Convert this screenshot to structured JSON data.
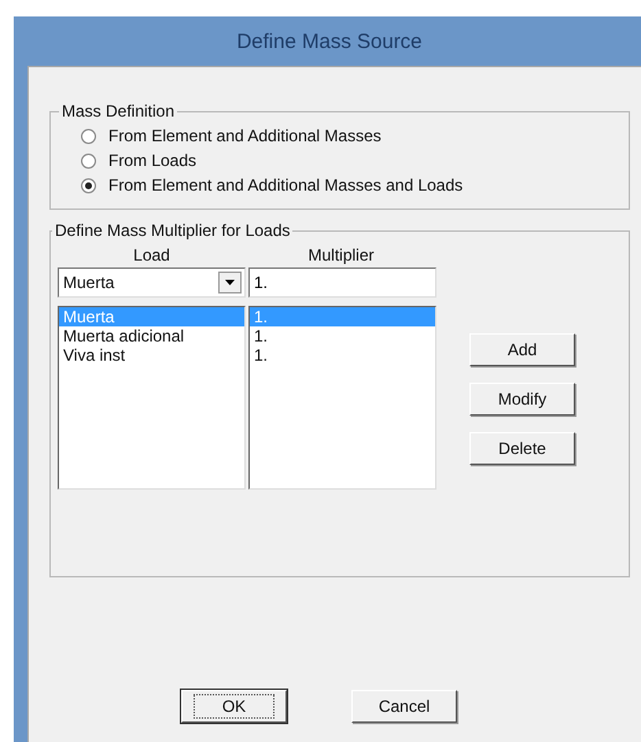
{
  "window": {
    "title": "Define Mass Source"
  },
  "mass_definition": {
    "title": "Mass Definition",
    "options": [
      {
        "label": "From Element and Additional Masses",
        "selected": false
      },
      {
        "label": "From Loads",
        "selected": false
      },
      {
        "label": "From Element and Additional Masses and Loads",
        "selected": true
      }
    ]
  },
  "multiplier_group": {
    "title": "Define Mass Multiplier for Loads",
    "load_header": "Load",
    "multiplier_header": "Multiplier",
    "load_combo": {
      "value": "Muerta"
    },
    "multiplier_field": {
      "value": "1."
    },
    "rows": [
      {
        "load": "Muerta",
        "multiplier": "1.",
        "selected": true
      },
      {
        "load": "Muerta adicional",
        "multiplier": "1.",
        "selected": false
      },
      {
        "load": "Viva inst",
        "multiplier": "1.",
        "selected": false
      }
    ],
    "buttons": [
      "Add",
      "Modify",
      "Delete"
    ]
  },
  "buttons": [
    {
      "label": "OK",
      "default": true
    },
    {
      "label": "Cancel",
      "default": false
    }
  ]
}
